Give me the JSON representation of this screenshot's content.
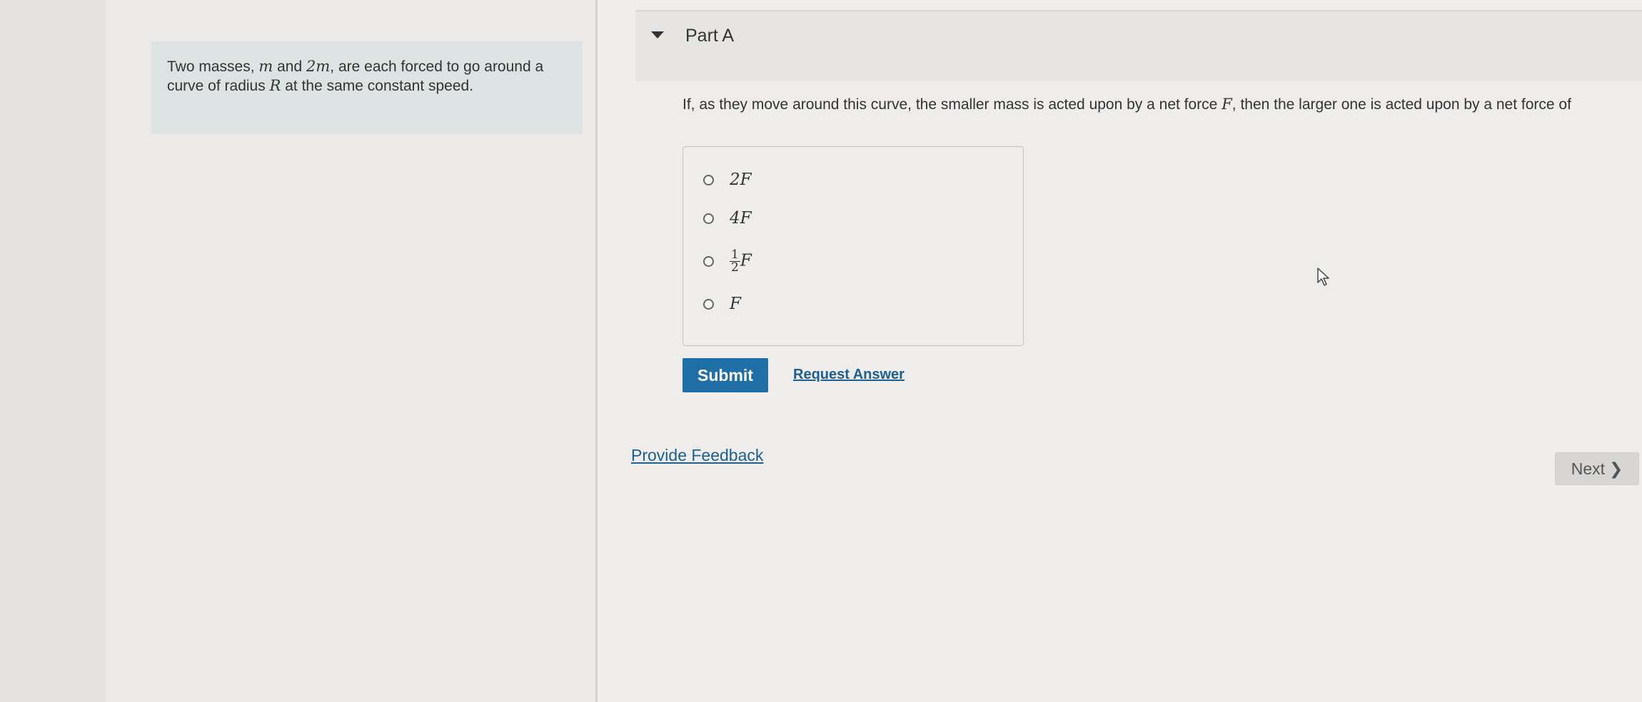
{
  "problem": {
    "t1": "Two masses, ",
    "v1": "m",
    "t2": " and ",
    "v2": "2m",
    "t3": ", are each forced to go around a curve of radius ",
    "v3": "R",
    "t4": " at the same constant speed."
  },
  "part": {
    "title": "Part A"
  },
  "question": {
    "t1": "If, as they move around this curve, the smaller mass is acted upon by a net force ",
    "v1": "F",
    "t2": ", then the larger one is acted upon by a net force of"
  },
  "choices": {
    "c1": "2F",
    "c2": "4F",
    "c3": {
      "num": "1",
      "den": "2",
      "var": "F"
    },
    "c4": "F"
  },
  "actions": {
    "submit": "Submit",
    "request_answer": "Request Answer",
    "provide_feedback": "Provide Feedback",
    "next": "Next",
    "next_chevron": "❯"
  },
  "colors": {
    "submit_bg": "#1f6fa6",
    "link": "#1f5f8f",
    "problem_bg": "#dde3e2"
  }
}
